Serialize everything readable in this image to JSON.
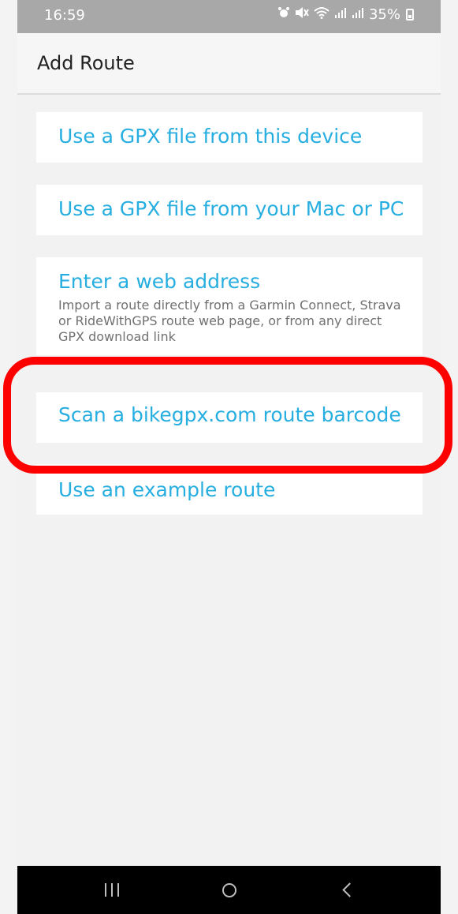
{
  "status_bar": {
    "time": "16:59",
    "battery_percent": "35%",
    "icons": [
      "alarm-icon",
      "mute-icon",
      "wifi-icon",
      "signal-icon",
      "signal-icon",
      "battery-icon"
    ]
  },
  "toolbar": {
    "title": "Add Route"
  },
  "options": [
    {
      "title": "Use a GPX file from this device"
    },
    {
      "title": "Use a GPX file from your Mac or PC"
    },
    {
      "title": "Enter a web address",
      "description": "Import a route directly from a Garmin Connect, Strava or RideWithGPS route web page, or from any direct GPX download link"
    },
    {
      "title": "Scan a bikegpx.com route barcode"
    },
    {
      "title": "Use an example route"
    }
  ],
  "colors": {
    "accent": "#27aee0",
    "highlight": "#ff0000",
    "status_bar": "#a8a8a8",
    "nav_bar": "#000000"
  },
  "nav_bar": {
    "buttons": [
      "recent-apps-icon",
      "home-icon",
      "back-icon"
    ]
  }
}
